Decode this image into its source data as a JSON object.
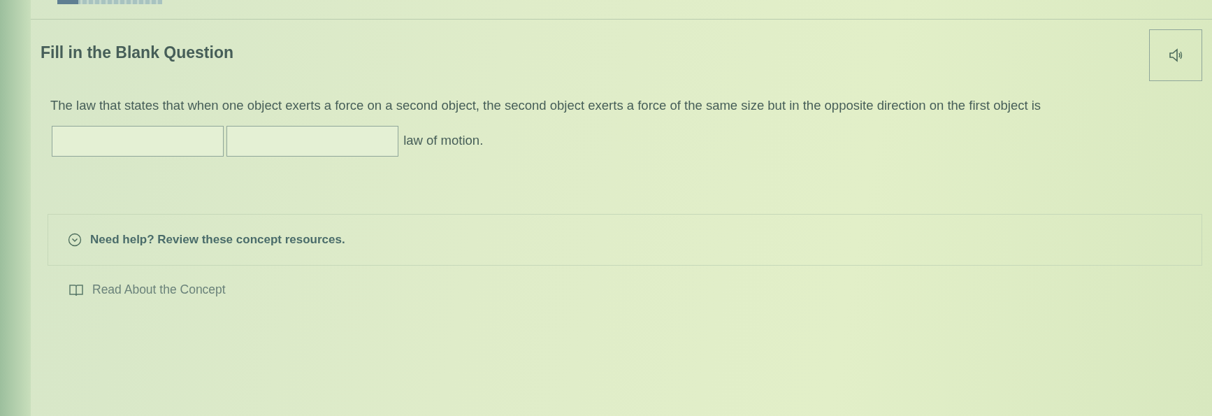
{
  "progress": {
    "level": 0.2
  },
  "question": {
    "title": "Fill in the Blank Question",
    "text_before": "The law that states that when one object exerts a force on a second object, the second object exerts a force of the same size but in the opposite direction on the first object is",
    "blanks": [
      {
        "kind": "text"
      },
      {
        "kind": "text"
      }
    ],
    "text_after": "law of motion."
  },
  "help": {
    "label": "Need help? Review these concept resources.",
    "expanded": true,
    "resources": [
      {
        "label": "Read About the Concept"
      }
    ]
  }
}
